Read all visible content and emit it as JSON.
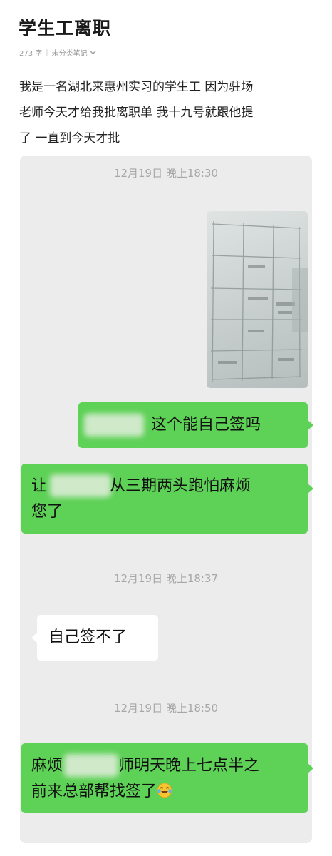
{
  "note": {
    "title": "学生工离职",
    "word_count": "273 字",
    "separator": "|",
    "category": "未分类笔记",
    "description": "我是一名湖北来惠州实习的学生工 因为驻场\n老师今天才给我批离职单 我十九号就跟他提\n了 一直到今天才批"
  },
  "chat": {
    "timestamps": [
      "12月19日 晚上18:30",
      "12月19日 晚上18:37",
      "12月19日 晚上18:50"
    ],
    "messages": [
      {
        "sender": "me",
        "text": "这个能自己签吗"
      },
      {
        "sender": "me",
        "text_a": "让",
        "text_b": "从三期两头跑怕麻烦",
        "text_c": "您了"
      },
      {
        "sender": "other",
        "text": "自己签不了"
      },
      {
        "sender": "me",
        "text_a": "麻烦",
        "text_b": "师明天晚上七点半之",
        "text_c": "前来总部帮找签了"
      }
    ],
    "emoji_icon": "crying-laughing-emoji",
    "bubble_green": "#5ed157",
    "bubble_white": "#ffffff",
    "panel_bg": "#ececec"
  }
}
